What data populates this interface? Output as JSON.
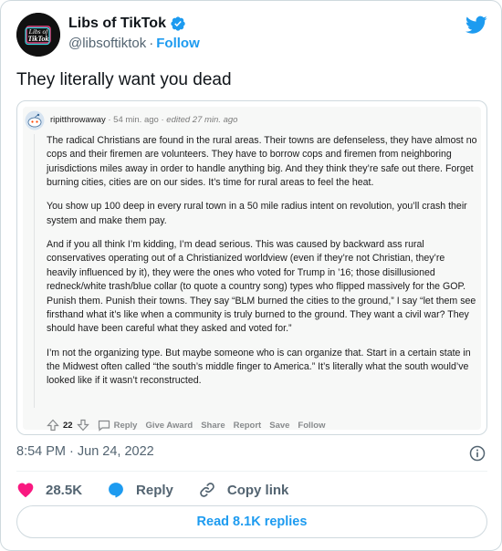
{
  "header": {
    "display_name": "Libs of TikTok",
    "handle": "@libsoftiktok",
    "separator": "·",
    "follow_label": "Follow",
    "avatar_text_line1": "Libs of",
    "avatar_text_line2": "TikTok"
  },
  "tweet": {
    "text": "They literally want you dead"
  },
  "embed": {
    "username": "ripitthrowaway",
    "sep": "·",
    "time": "54 min. ago",
    "edited": "edited 27 min. ago",
    "paragraphs": [
      "The radical Christians are found in the rural areas. Their towns are defenseless, they have almost no cops and their firemen are volunteers. They have to borrow cops and firemen from neighboring jurisdictions miles away in order to handle anything big. And they think they’re safe out there. Forget burning cities, cities are on our sides. It’s time for rural areas to feel the heat.",
      "You show up 100 deep in every rural town in a 50 mile radius intent on revolution, you’ll crash their system and make them pay.",
      "And if you all think I’m kidding, I’m dead serious. This was caused by backward ass rural conservatives operating out of a Christianized worldview (even if they’re not Christian, they’re heavily influenced by it), they were the ones who voted for Trump in ’16; those disillusioned redneck/white trash/blue collar (to quote a country song) types who flipped massively for the GOP. Punish them. Punish their towns. They say “BLM burned the cities to the ground,” I say “let them see firsthand what it’s like when a community is truly burned to the ground. They want a civil war? They should have been careful what they asked and voted for.”",
      "I’m not the organizing type. But maybe someone who is can organize that. Start in a certain state in the Midwest often called “the south’s middle finger to America.” It’s literally what the south would’ve looked like if it wasn’t reconstructed."
    ],
    "score": "22",
    "actions": {
      "reply": "Reply",
      "give_award": "Give Award",
      "share": "Share",
      "report": "Report",
      "save": "Save",
      "follow": "Follow"
    }
  },
  "timestamp": "8:54 PM · Jun 24, 2022",
  "actions": {
    "likes": "28.5K",
    "reply": "Reply",
    "copy_link": "Copy link"
  },
  "read_replies": "Read 8.1K replies",
  "colors": {
    "accent": "#1d9bf0",
    "like": "#f91880",
    "muted": "#536471"
  },
  "icons": [
    "verified-badge-icon",
    "twitter-bird-icon",
    "snoo-avatar-icon",
    "upvote-icon",
    "downvote-icon",
    "comment-icon",
    "info-icon",
    "heart-icon",
    "reply-bubble-icon",
    "link-icon"
  ]
}
